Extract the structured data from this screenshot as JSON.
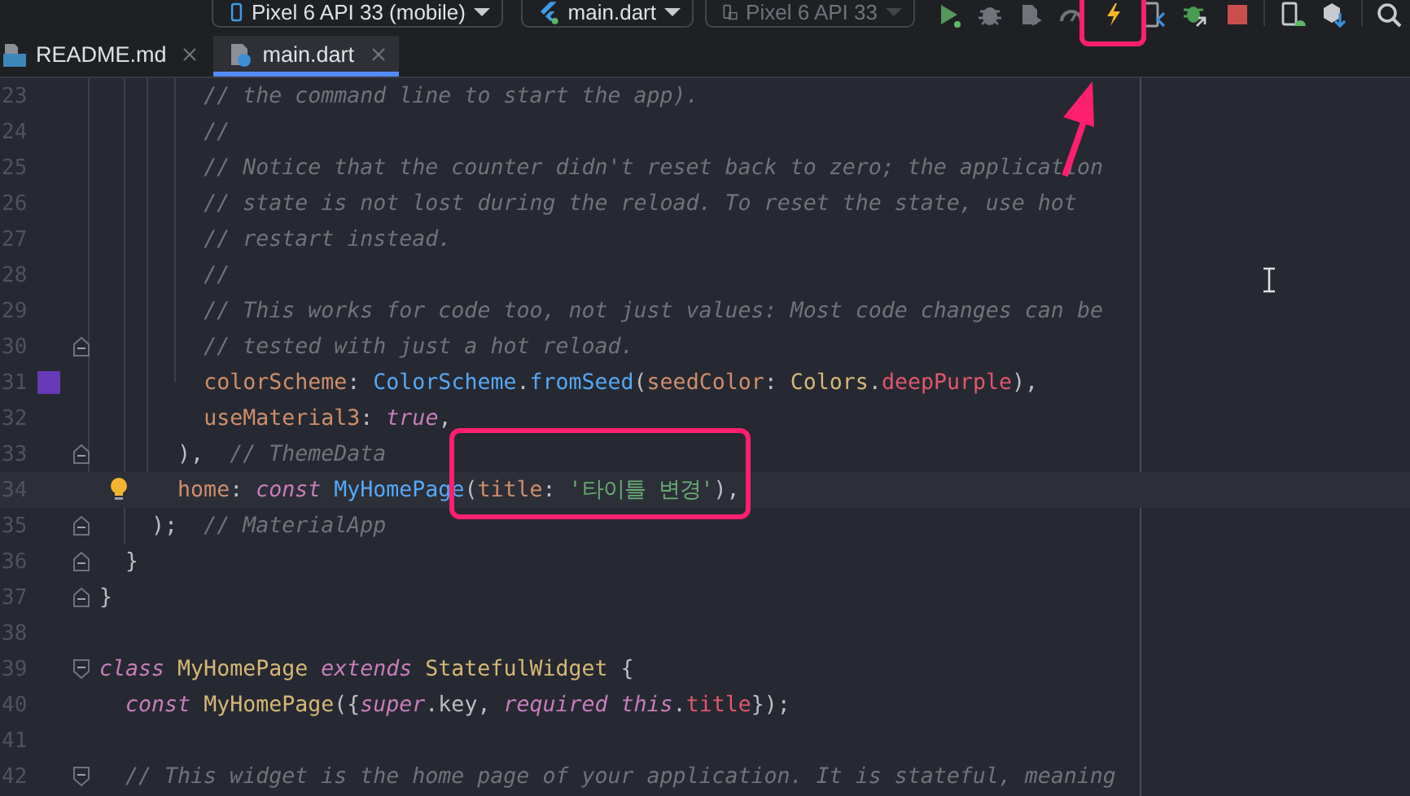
{
  "toolbar": {
    "device_selector": {
      "label": "Pixel 6 API 33 (mobile)"
    },
    "run_config": {
      "label": "main.dart"
    },
    "secondary_device": {
      "label": "Pixel 6 API 33",
      "disabled": true
    }
  },
  "tabs": [
    {
      "label": "README.md",
      "kind": "markdown",
      "selected": false
    },
    {
      "label": "main.dart",
      "kind": "dart",
      "selected": true
    }
  ],
  "editor": {
    "lines": [
      {
        "number": "23",
        "tokens": [
          {
            "kind": "comment",
            "text": "        // the command line to start the app)."
          }
        ]
      },
      {
        "number": "24",
        "tokens": [
          {
            "kind": "comment",
            "text": "        //"
          }
        ]
      },
      {
        "number": "25",
        "tokens": [
          {
            "kind": "comment",
            "text": "        // Notice that the counter didn't reset back to zero; the application"
          }
        ]
      },
      {
        "number": "26",
        "tokens": [
          {
            "kind": "comment",
            "text": "        // state is not lost during the reload. To reset the state, use hot"
          }
        ]
      },
      {
        "number": "27",
        "tokens": [
          {
            "kind": "comment",
            "text": "        // restart instead."
          }
        ]
      },
      {
        "number": "28",
        "tokens": [
          {
            "kind": "comment",
            "text": "        //"
          }
        ]
      },
      {
        "number": "29",
        "tokens": [
          {
            "kind": "comment",
            "text": "        // This works for code too, not just values: Most code changes can be"
          }
        ]
      },
      {
        "number": "30",
        "fold_end": true,
        "tokens": [
          {
            "kind": "comment",
            "text": "        // tested with just a hot reload."
          }
        ]
      },
      {
        "number": "31",
        "color": "#673ab7",
        "tokens": [
          {
            "kind": "param",
            "text": "        colorScheme"
          },
          {
            "kind": "plain",
            "text": ": "
          },
          {
            "kind": "method",
            "text": "ColorScheme"
          },
          {
            "kind": "plain",
            "text": "."
          },
          {
            "kind": "method",
            "text": "fromSeed"
          },
          {
            "kind": "plain",
            "text": "("
          },
          {
            "kind": "param",
            "text": "seedColor"
          },
          {
            "kind": "plain",
            "text": ": "
          },
          {
            "kind": "type",
            "text": "Colors"
          },
          {
            "kind": "plain",
            "text": "."
          },
          {
            "kind": "field",
            "text": "deepPurple"
          },
          {
            "kind": "plain",
            "text": "),"
          }
        ]
      },
      {
        "number": "32",
        "tokens": [
          {
            "kind": "param",
            "text": "        useMaterial3"
          },
          {
            "kind": "plain",
            "text": ": "
          },
          {
            "kind": "keyword",
            "text": "true"
          },
          {
            "kind": "plain",
            "text": ","
          }
        ]
      },
      {
        "number": "33",
        "fold_end": true,
        "tokens": [
          {
            "kind": "plain",
            "text": "      ),  "
          },
          {
            "kind": "comment",
            "text": "// ThemeData"
          }
        ]
      },
      {
        "number": "34",
        "current": true,
        "bulb": true,
        "tokens": [
          {
            "kind": "param",
            "text": "      home"
          },
          {
            "kind": "plain",
            "text": ": "
          },
          {
            "kind": "keyword",
            "text": "const "
          },
          {
            "kind": "method",
            "text": "MyHomePage"
          },
          {
            "kind": "plain",
            "text": "("
          },
          {
            "kind": "param",
            "text": "title"
          },
          {
            "kind": "plain",
            "text": ": "
          },
          {
            "kind": "string",
            "text": "'타이틀 변경'"
          },
          {
            "kind": "plain",
            "text": "),"
          }
        ]
      },
      {
        "number": "35",
        "fold_end": true,
        "tokens": [
          {
            "kind": "plain",
            "text": "    );  "
          },
          {
            "kind": "comment",
            "text": "// MaterialApp"
          }
        ]
      },
      {
        "number": "36",
        "fold_end": true,
        "tokens": [
          {
            "kind": "plain",
            "text": "  }"
          }
        ]
      },
      {
        "number": "37",
        "fold_end": true,
        "tokens": [
          {
            "kind": "plain",
            "text": "}"
          }
        ]
      },
      {
        "number": "38"
      },
      {
        "number": "39",
        "fold_start": true,
        "tokens": [
          {
            "kind": "keyword",
            "text": "class "
          },
          {
            "kind": "type",
            "text": "MyHomePage "
          },
          {
            "kind": "keyword",
            "text": "extends "
          },
          {
            "kind": "type",
            "text": "StatefulWidget"
          },
          {
            "kind": "plain",
            "text": " {"
          }
        ]
      },
      {
        "number": "40",
        "tokens": [
          {
            "kind": "keyword",
            "text": "  const "
          },
          {
            "kind": "type",
            "text": "MyHomePage"
          },
          {
            "kind": "plain",
            "text": "({"
          },
          {
            "kind": "keyword",
            "text": "super"
          },
          {
            "kind": "plain",
            "text": ".key, "
          },
          {
            "kind": "keyword",
            "text": "required this"
          },
          {
            "kind": "plain",
            "text": "."
          },
          {
            "kind": "field",
            "text": "title"
          },
          {
            "kind": "plain",
            "text": "});"
          }
        ]
      },
      {
        "number": "41"
      },
      {
        "number": "42",
        "fold_start": true,
        "tokens": [
          {
            "kind": "comment",
            "text": "  // This widget is the home page of your application. It is stateful, meaning"
          }
        ]
      }
    ]
  }
}
